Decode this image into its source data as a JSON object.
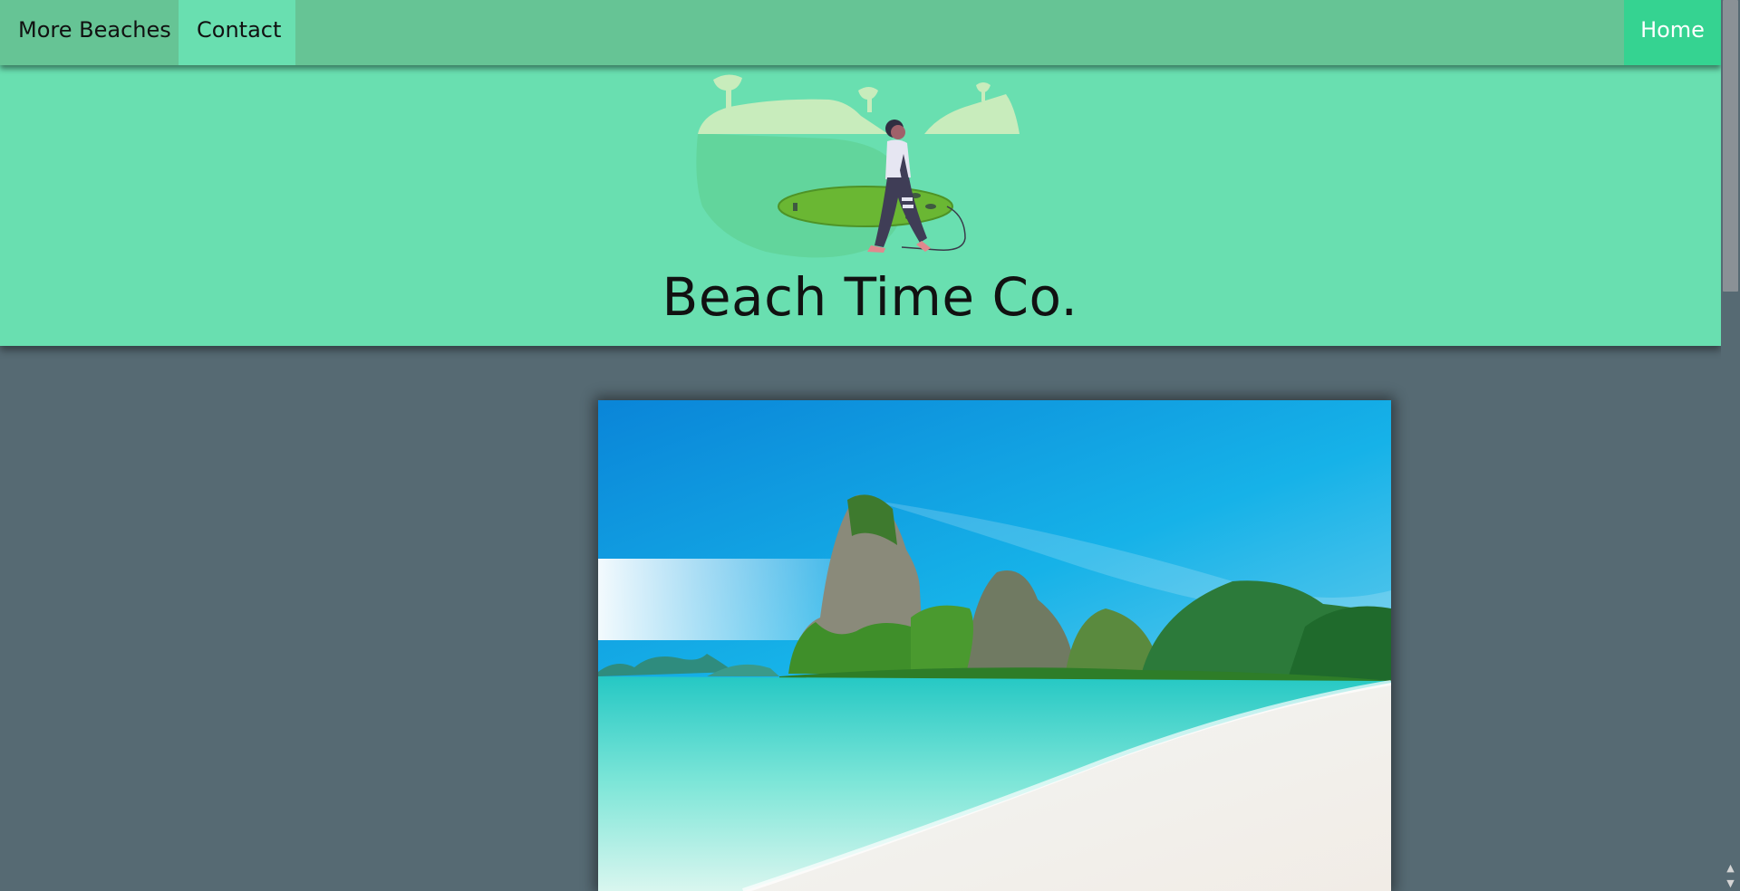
{
  "nav": {
    "more_beaches": "More Beaches",
    "contact": "Contact",
    "home": "Home"
  },
  "banner": {
    "title": "Beach Time Co."
  },
  "colors": {
    "navbar": "#66c495",
    "banner": "#69dfb0",
    "active_tab": "#69dfb0",
    "home_button": "#35d391",
    "page_background": "#566a73"
  },
  "icons": {
    "banner_art": "surfer-illustration",
    "hero": "beach-photo"
  }
}
